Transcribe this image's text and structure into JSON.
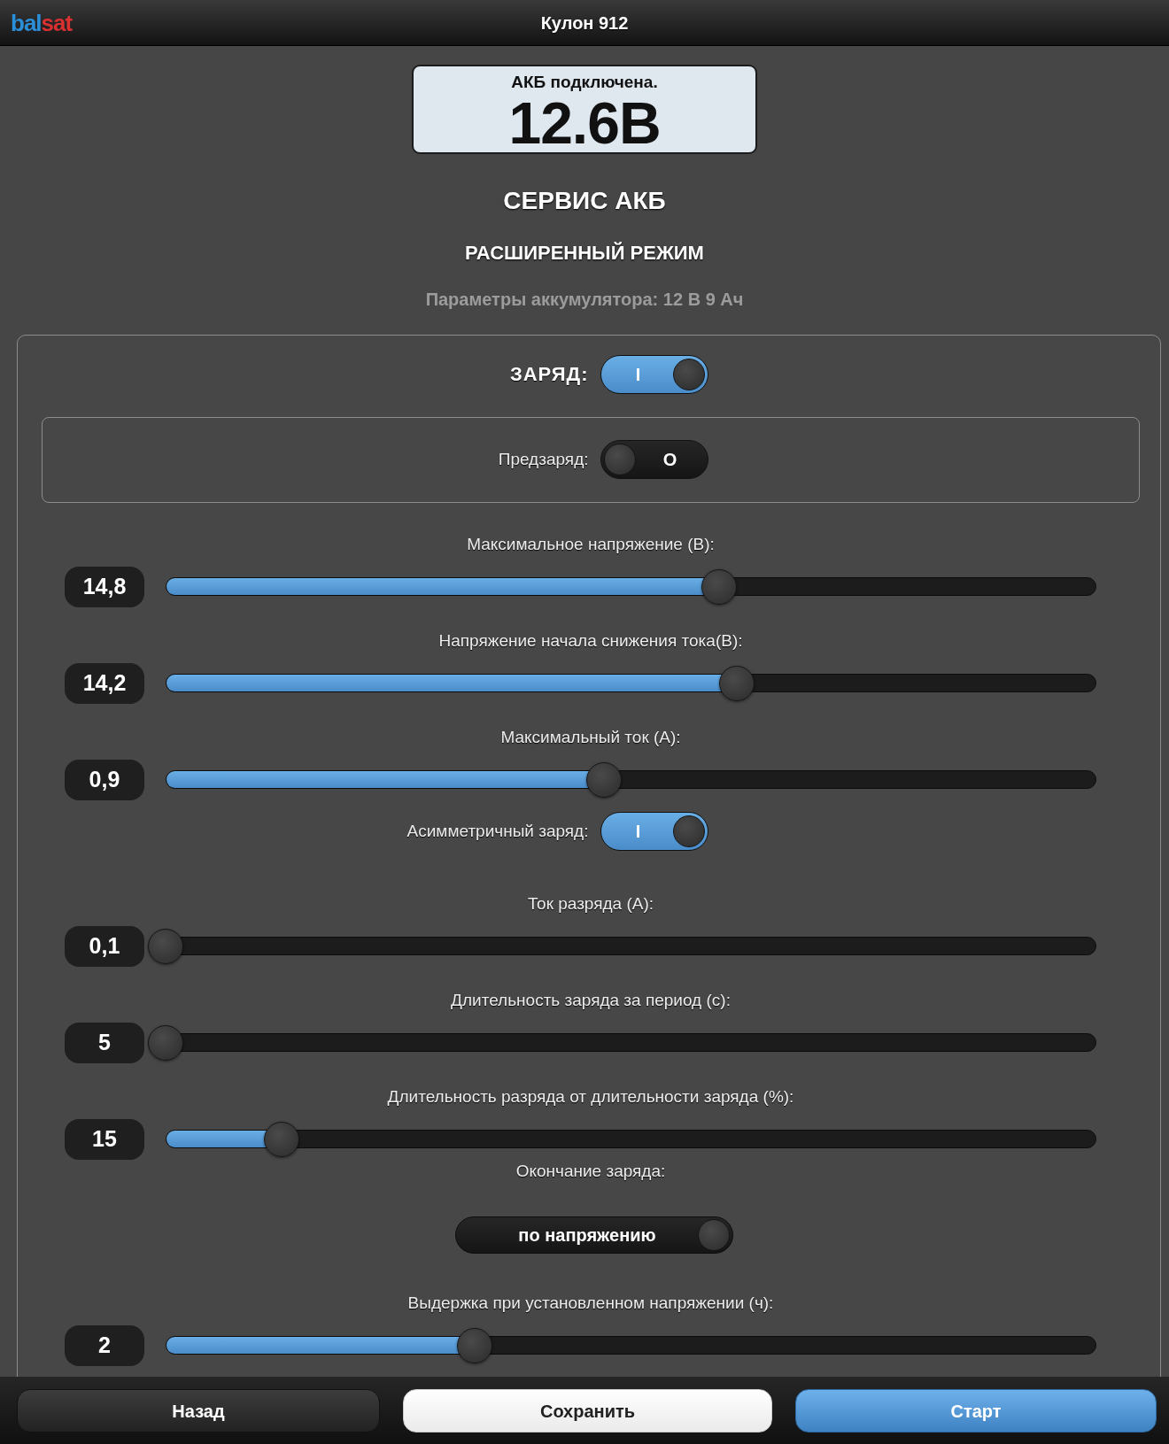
{
  "header": {
    "logo": [
      {
        "text": "bal",
        "color": "#2b8ed8"
      },
      {
        "text": "sat",
        "color": "#d93030"
      }
    ],
    "title": "Кулон 912"
  },
  "status_display": {
    "message": "АКБ подключена.",
    "voltage": "12.6В"
  },
  "heading": "СЕРВИС АКБ",
  "subheading": "РАСШИРЕННЫЙ РЕЖИМ",
  "battery_info": "Параметры аккумулятора: 12 В 9 Ач",
  "panel": {
    "items": [
      {
        "kind": "main_toggle",
        "label": "ЗАРЯД:",
        "on": true,
        "switch_text": "I"
      },
      {
        "kind": "group",
        "items": [
          {
            "kind": "toggle",
            "label": "Предзаряд:",
            "on": false,
            "switch_text": "O"
          }
        ]
      },
      {
        "kind": "slider",
        "label": "Максимальное напряжение (В):",
        "value": "14,8",
        "level": 0.595
      },
      {
        "kind": "slider",
        "label": "Напряжение начала снижения тока(В):",
        "value": "14,2",
        "level": 0.614
      },
      {
        "kind": "slider",
        "label": "Максимальный ток (А):",
        "value": "0,9",
        "level": 0.471
      },
      {
        "kind": "toggle",
        "label": "Асимметричный заряд:",
        "on": true,
        "switch_text": "I"
      },
      {
        "kind": "slider",
        "label": "Ток разряда (А):",
        "value": "0,1",
        "level": 0
      },
      {
        "kind": "slider",
        "label": "Длительность заряда за период (с):",
        "value": "5",
        "level": 0
      },
      {
        "kind": "slider",
        "label": "Длительность разряда от длительности заряда (%):",
        "value": "15",
        "level": 0.125
      },
      {
        "kind": "choice",
        "label": "Окончание заряда:",
        "value": "по напряжению",
        "on": true
      },
      {
        "kind": "slider",
        "label": "Выдержка при установленном напряжении (ч):",
        "value": "2",
        "level": 0.332
      }
    ]
  },
  "footer": {
    "buttons": [
      {
        "label": "Назад",
        "kind": "dark"
      },
      {
        "label": "Сохранить",
        "kind": "light"
      },
      {
        "label": "Старт",
        "kind": "primary"
      }
    ]
  }
}
